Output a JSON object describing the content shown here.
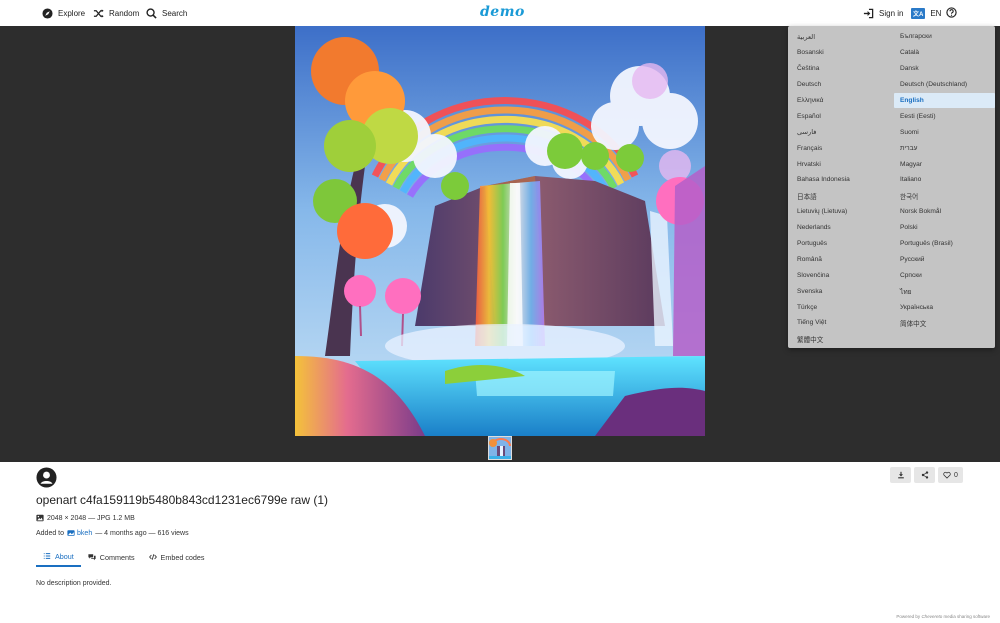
{
  "nav": {
    "explore": "Explore",
    "random": "Random",
    "search": "Search",
    "logo": "demo",
    "sign_in": "Sign in",
    "lang_code": "EN",
    "lang_badge": "文A"
  },
  "languages": [
    {
      "label": "العربية",
      "active": false
    },
    {
      "label": "Български",
      "active": false
    },
    {
      "label": "Bosanski",
      "active": false
    },
    {
      "label": "Català",
      "active": false
    },
    {
      "label": "Čeština",
      "active": false
    },
    {
      "label": "Dansk",
      "active": false
    },
    {
      "label": "Deutsch",
      "active": false
    },
    {
      "label": "Deutsch (Deutschland)",
      "active": false
    },
    {
      "label": "Ελληνικά",
      "active": false
    },
    {
      "label": "English",
      "active": true
    },
    {
      "label": "Español",
      "active": false
    },
    {
      "label": "Eesti (Eesti)",
      "active": false
    },
    {
      "label": "فارسی",
      "active": false
    },
    {
      "label": "Suomi",
      "active": false
    },
    {
      "label": "Français",
      "active": false
    },
    {
      "label": "עברית",
      "active": false
    },
    {
      "label": "Hrvatski",
      "active": false
    },
    {
      "label": "Magyar",
      "active": false
    },
    {
      "label": "Bahasa Indonesia",
      "active": false
    },
    {
      "label": "Italiano",
      "active": false
    },
    {
      "label": "日本語",
      "active": false
    },
    {
      "label": "한국어",
      "active": false
    },
    {
      "label": "Lietuvių (Lietuva)",
      "active": false
    },
    {
      "label": "Norsk Bokmål",
      "active": false
    },
    {
      "label": "Nederlands",
      "active": false
    },
    {
      "label": "Polski",
      "active": false
    },
    {
      "label": "Português",
      "active": false
    },
    {
      "label": "Português (Brasil)",
      "active": false
    },
    {
      "label": "Română",
      "active": false
    },
    {
      "label": "Русский",
      "active": false
    },
    {
      "label": "Slovenčina",
      "active": false
    },
    {
      "label": "Српски",
      "active": false
    },
    {
      "label": "Svenska",
      "active": false
    },
    {
      "label": "ไทย",
      "active": false
    },
    {
      "label": "Türkçe",
      "active": false
    },
    {
      "label": "Українська",
      "active": false
    },
    {
      "label": "Tiếng Việt",
      "active": false
    },
    {
      "label": "简体中文",
      "active": false
    },
    {
      "label": "繁體中文",
      "active": false
    }
  ],
  "image": {
    "title": "openart c4fa159119b5480b843cd1231ec6799e raw (1)",
    "meta": "2048 × 2048 — JPG 1.2 MB",
    "added_to_label": "Added to",
    "album": "bkeh",
    "added_suffix": "— 4 months ago — 616 views",
    "like_count": "0",
    "description": "No description provided."
  },
  "tabs": {
    "about": "About",
    "comments": "Comments",
    "embed": "Embed codes"
  },
  "footer": {
    "powered_by": "Powered by",
    "brand": "Chevereto",
    "software": "media sharing software"
  },
  "colors": {
    "accent": "#1a6fc1",
    "viewer_bg": "#2d2d2d",
    "dropdown_bg": "#c4c4c4"
  }
}
